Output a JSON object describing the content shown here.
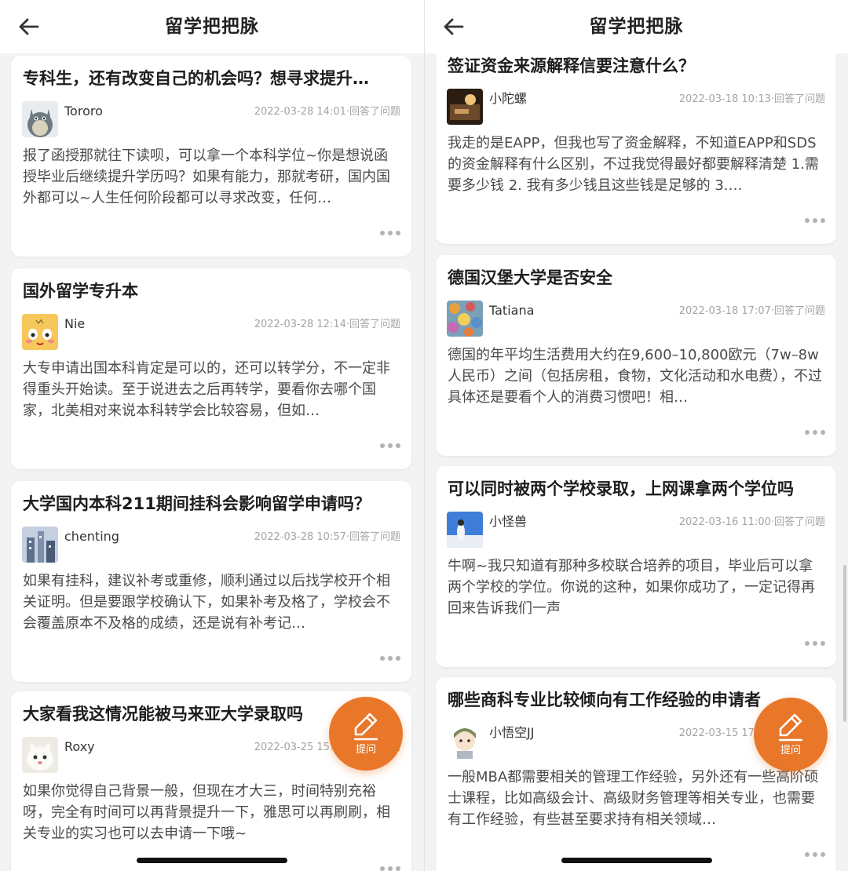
{
  "left": {
    "title": "留学把把脉",
    "fab_label": "提问",
    "cards": [
      {
        "title": "专科生，还有改变自己的机会吗？想寻求提升…",
        "author": "Tororo",
        "meta": "2022-03-28 14:01·回答了问题",
        "excerpt": "报了函授那就往下读呗，可以拿一个本科学位~你是想说函授毕业后继续提升学历吗？如果有能力，那就考研，国内国外都可以~人生任何阶段都可以寻求改变，任何…"
      },
      {
        "title": "国外留学专升本",
        "author": "Nie",
        "meta": "2022-03-28 12:14·回答了问题",
        "excerpt": "大专申请出国本科肯定是可以的，还可以转学分，不一定非得重头开始读。至于说进去之后再转学，要看你去哪个国家，北美相对来说本科转学会比较容易，但如…"
      },
      {
        "title": "大学国内本科211期间挂科会影响留学申请吗？",
        "author": "chenting",
        "meta": "2022-03-28 10:57·回答了问题",
        "excerpt": "如果有挂科，建议补考或重修，顺利通过以后找学校开个相关证明。但是要跟学校确认下，如果补考及格了，学校会不会覆盖原本不及格的成绩，还是说有补考记…"
      },
      {
        "title": "大家看我这情况能被马来亚大学录取吗",
        "author": "Roxy",
        "meta": "2022-03-25 15:50·回答了问题",
        "excerpt": "如果你觉得自己背景一般，但现在才大三，时间特别充裕呀，完全有时间可以再背景提升一下，雅思可以再刷刷，相关专业的实习也可以去申请一下哦~"
      }
    ]
  },
  "right": {
    "title": "留学把把脉",
    "fab_label": "提问",
    "cards": [
      {
        "title": "签证资金来源解释信要注意什么？",
        "author": "小陀螺",
        "meta": "2022-03-18 10:13·回答了问题",
        "excerpt": "我走的是EAPP，但我也写了资金解释，不知道EAPP和SDS的资金解释有什么区别，不过我觉得最好都要解释清楚 1.需要多少钱 2. 我有多少钱且这些钱是足够的 3.…"
      },
      {
        "title": "德国汉堡大学是否安全",
        "author": "Tatiana",
        "meta": "2022-03-18 17:07·回答了问题",
        "excerpt": "德国的年平均生活费用大约在9,600–10,800欧元（7w–8w人民币）之间（包括房租，食物，文化活动和水电费），不过具体还是要看个人的消费习惯吧！相…"
      },
      {
        "title": "可以同时被两个学校录取，上网课拿两个学位吗",
        "author": "小怪兽",
        "meta": "2022-03-16 11:00·回答了问题",
        "excerpt": "牛啊~我只知道有那种多校联合培养的项目，毕业后可以拿两个学校的学位。你说的这种，如果你成功了，一定记得再回来告诉我们一声"
      },
      {
        "title": "哪些商科专业比较倾向有工作经验的申请者",
        "author": "小悟空JJ",
        "meta": "2022-03-15 17:45·回答了问题",
        "excerpt": "一般MBA都需要相关的管理工作经验，另外还有一些高阶硕士课程，比如高级会计、高级财务管理等相关专业，也需要有工作经验，有些甚至要求持有相关领域…"
      }
    ]
  }
}
